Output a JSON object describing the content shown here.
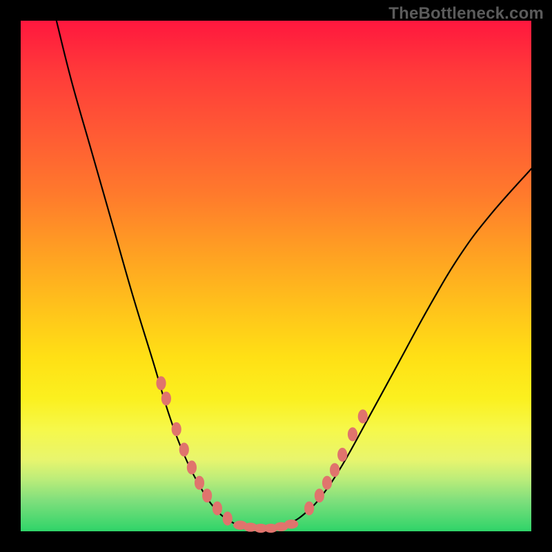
{
  "watermark": "TheBottleneck.com",
  "colors": {
    "frame": "#000000",
    "marker": "#e0746d",
    "curve": "#000000",
    "gradient_stops": [
      {
        "pos": 0,
        "hex": "#ff173e"
      },
      {
        "pos": 10,
        "hex": "#ff3a3a"
      },
      {
        "pos": 22,
        "hex": "#ff5a34"
      },
      {
        "pos": 34,
        "hex": "#ff7a2c"
      },
      {
        "pos": 46,
        "hex": "#ffa222"
      },
      {
        "pos": 58,
        "hex": "#ffc81a"
      },
      {
        "pos": 66,
        "hex": "#ffe015"
      },
      {
        "pos": 74,
        "hex": "#fbf01f"
      },
      {
        "pos": 80,
        "hex": "#f6f84a"
      },
      {
        "pos": 86,
        "hex": "#e8f56e"
      },
      {
        "pos": 90,
        "hex": "#b9ec7a"
      },
      {
        "pos": 94,
        "hex": "#7fdf7c"
      },
      {
        "pos": 100,
        "hex": "#2fd469"
      }
    ]
  },
  "chart_data": {
    "type": "line",
    "title": "",
    "xlabel": "",
    "ylabel": "",
    "x_range": [
      0,
      100
    ],
    "y_range": [
      0,
      100
    ],
    "note": "Coordinates are in percent of the inner plot area (0,0 = top-left, 100,100 = bottom-right). Values are estimated from pixel positions since no axis ticks are shown.",
    "curve": [
      {
        "x": 7,
        "y": 0
      },
      {
        "x": 10,
        "y": 12
      },
      {
        "x": 14,
        "y": 26
      },
      {
        "x": 18,
        "y": 40
      },
      {
        "x": 22,
        "y": 54
      },
      {
        "x": 26,
        "y": 67
      },
      {
        "x": 29,
        "y": 77
      },
      {
        "x": 32,
        "y": 85
      },
      {
        "x": 35,
        "y": 91
      },
      {
        "x": 38,
        "y": 95.5
      },
      {
        "x": 41,
        "y": 98
      },
      {
        "x": 44,
        "y": 99.2
      },
      {
        "x": 47,
        "y": 99.5
      },
      {
        "x": 50,
        "y": 99.3
      },
      {
        "x": 53,
        "y": 98.3
      },
      {
        "x": 56,
        "y": 96.2
      },
      {
        "x": 59,
        "y": 93
      },
      {
        "x": 63,
        "y": 87
      },
      {
        "x": 68,
        "y": 78
      },
      {
        "x": 74,
        "y": 67
      },
      {
        "x": 80,
        "y": 56
      },
      {
        "x": 86,
        "y": 46
      },
      {
        "x": 92,
        "y": 38
      },
      {
        "x": 100,
        "y": 29
      }
    ],
    "markers_left": [
      {
        "x": 27.5,
        "y": 71
      },
      {
        "x": 28.5,
        "y": 74
      },
      {
        "x": 30.5,
        "y": 80
      },
      {
        "x": 32.0,
        "y": 84
      },
      {
        "x": 33.5,
        "y": 87.5
      },
      {
        "x": 35.0,
        "y": 90.5
      },
      {
        "x": 36.5,
        "y": 93
      },
      {
        "x": 38.5,
        "y": 95.5
      },
      {
        "x": 40.5,
        "y": 97.5
      }
    ],
    "markers_bottom": [
      {
        "x": 43.0,
        "y": 98.8
      },
      {
        "x": 45.0,
        "y": 99.2
      },
      {
        "x": 47.0,
        "y": 99.4
      },
      {
        "x": 49.0,
        "y": 99.4
      },
      {
        "x": 51.0,
        "y": 99.1
      },
      {
        "x": 53.0,
        "y": 98.6
      }
    ],
    "markers_right": [
      {
        "x": 56.5,
        "y": 95.5
      },
      {
        "x": 58.5,
        "y": 93
      },
      {
        "x": 60.0,
        "y": 90.5
      },
      {
        "x": 61.5,
        "y": 88
      },
      {
        "x": 63.0,
        "y": 85
      },
      {
        "x": 65.0,
        "y": 81
      },
      {
        "x": 67.0,
        "y": 77.5
      }
    ]
  }
}
